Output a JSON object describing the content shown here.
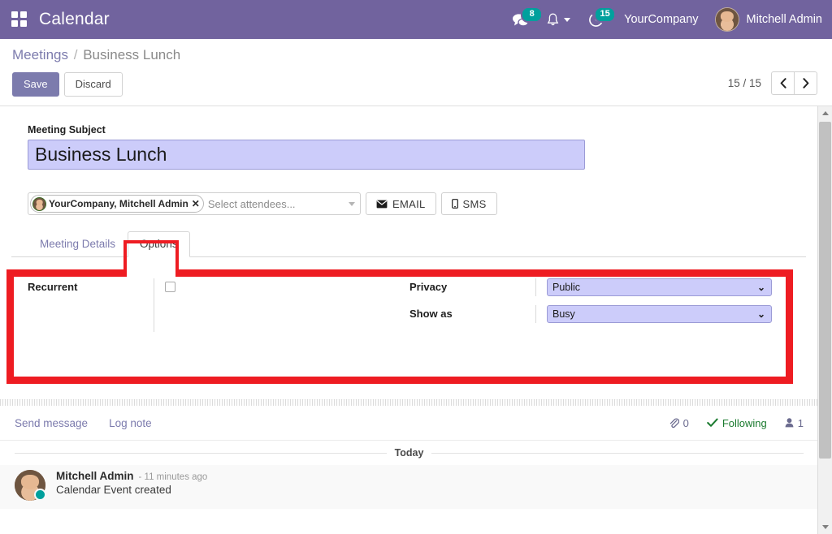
{
  "navbar": {
    "apps_icon": "apps-grid-icon",
    "brand": "Calendar",
    "messages": {
      "icon": "chat-icon",
      "count": "8"
    },
    "activities_bell": {
      "icon": "bell-icon"
    },
    "clock": {
      "icon": "activity-clock-icon",
      "count": "15"
    },
    "company": "YourCompany",
    "user": "Mitchell Admin",
    "accent_color": "#71639e",
    "badge_color": "#00a09d"
  },
  "control_panel": {
    "breadcrumb": {
      "parent": "Meetings",
      "separator": "/",
      "current": "Business Lunch"
    },
    "save_label": "Save",
    "discard_label": "Discard",
    "pager": {
      "text": "15 / 15",
      "prev_icon": "chevron-left-icon",
      "next_icon": "chevron-right-icon"
    }
  },
  "form": {
    "subject": {
      "label": "Meeting Subject",
      "value": "Business Lunch"
    },
    "attendees": {
      "tag": "YourCompany, Mitchell Admin",
      "remove_icon": "remove-tag-icon",
      "placeholder": "Select attendees...",
      "dropdown_icon": "chevron-down-icon"
    },
    "email_button": {
      "label": "EMAIL",
      "icon": "envelope-icon"
    },
    "sms_button": {
      "label": "SMS",
      "icon": "mobile-phone-icon"
    },
    "tabs": [
      {
        "label": "Meeting Details",
        "active": false
      },
      {
        "label": "Options",
        "active": true
      }
    ],
    "options": {
      "recurrent_label": "Recurrent",
      "recurrent_checked": false,
      "privacy_label": "Privacy",
      "privacy_value": "Public",
      "show_as_label": "Show as",
      "show_as_value": "Busy",
      "field_fill": "#ccccfa"
    }
  },
  "chatter": {
    "send_message": "Send message",
    "log_note": "Log note",
    "attachments": {
      "icon": "paperclip-icon",
      "count": "0"
    },
    "following": {
      "icon": "check-icon",
      "label": "Following",
      "color": "#1a7a2e"
    },
    "followers": {
      "icon": "user-icon",
      "count": "1"
    },
    "today_label": "Today",
    "message": {
      "author": "Mitchell Admin",
      "time": "- 11 minutes ago",
      "body": "Calendar Event created"
    }
  },
  "annotation": {
    "color": "#ee1c22",
    "target": "options-tab-and-panel"
  },
  "scrollbar": {
    "up_icon": "scroll-up-arrow-icon",
    "down_icon": "scroll-down-arrow-icon"
  }
}
